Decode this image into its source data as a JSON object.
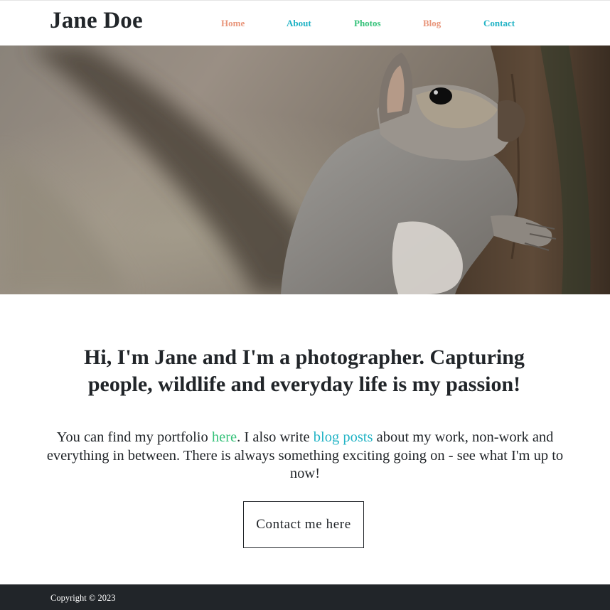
{
  "site": {
    "brand": "Jane Doe"
  },
  "nav": {
    "items": [
      {
        "label": "Home",
        "color": "#e8957a"
      },
      {
        "label": "About",
        "color": "#21b3c5"
      },
      {
        "label": "Photos",
        "color": "#36c27a"
      },
      {
        "label": "Blog",
        "color": "#e8957a"
      },
      {
        "label": "Contact",
        "color": "#21b3c5"
      }
    ]
  },
  "hero": {
    "image": "squirrel-on-tree-photo"
  },
  "main": {
    "headline": "Hi, I'm Jane and I'm a photographer. Capturing people, wildlife and everyday life is my passion!",
    "intro_before": "You can find my portfolio ",
    "portfolio_link": "here",
    "intro_middle": ". I also write ",
    "blog_link": "blog posts",
    "intro_after": " about my work, non-work and everything in between. There is always something exciting going on - see what I'm up to now!",
    "cta_label": "Contact me here"
  },
  "colors": {
    "link_green": "#36c27a",
    "link_teal": "#21b3c5",
    "footer_bg": "#212529"
  },
  "footer": {
    "copyright": "Copyright © 2023"
  }
}
